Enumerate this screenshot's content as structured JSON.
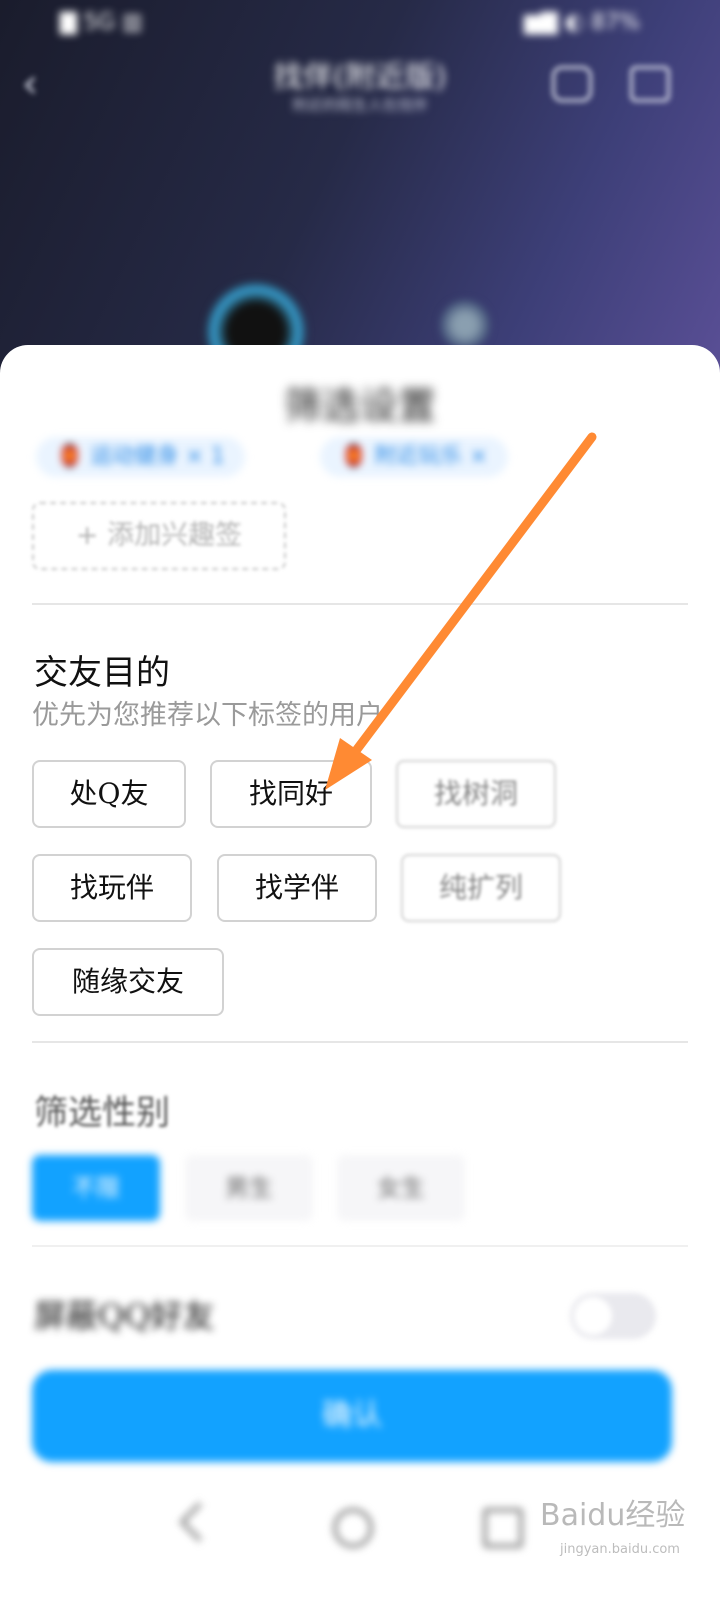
{
  "status_bar": {
    "left": "▇ 5G ▥",
    "right": "▆▇ ◐ 87%"
  },
  "header": {
    "title": "找伴(附近版)",
    "subtitle": "附近的陌生人在找伴"
  },
  "sheet": {
    "title": "筛选设置",
    "interest_tags": [
      "🏮 运动健身 × 1",
      "🏮 附近玩乐 ×"
    ],
    "add_tag_label": "+ 添加兴趣签"
  },
  "purpose": {
    "title": "交友目的",
    "subtitle": "优先为您推荐以下标签的用户",
    "tags": [
      "处Q友",
      "找同好",
      "找树洞",
      "找玩伴",
      "找学伴",
      "纯扩列",
      "随缘交友"
    ]
  },
  "gender": {
    "title": "筛选性别",
    "options": [
      "不限",
      "男生",
      "女生"
    ],
    "selected": "不限"
  },
  "hide_row": {
    "label": "屏蔽QQ好友",
    "enabled": false
  },
  "confirm_label": "确认",
  "watermark": {
    "text": "Baidu经验",
    "url": "jingyan.baidu.com"
  },
  "colors": {
    "accent": "#12a2ff",
    "annotation_arrow": "#ff8a33"
  }
}
